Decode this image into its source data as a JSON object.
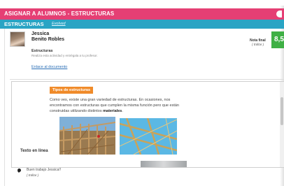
{
  "header": {
    "title": "ASIGNAR A ALUMNOS - ESTRUCTURAS"
  },
  "subheader": {
    "title": "ESTRUCTURAS",
    "link": "Evolved"
  },
  "student": {
    "first_name": "Jessica",
    "last_name": "Benito Robles"
  },
  "grade": {
    "label": "Nota final",
    "edit": "( Editar )",
    "value": "8,5",
    "color": "#3fb045"
  },
  "activity": {
    "title": "Estructuras",
    "description": "Realiza esta actividad y entrégala a tu profesor.",
    "document_link": "Enlace al documento"
  },
  "viewer": {
    "tag": "Tipos de estructuras",
    "paragraph_plain": "Como ves, existe una gran variedad de estructuras. En ocasiones, nos encontramos con estructuras que cumplen la misma función pero que están construidas utilizando distintos ",
    "paragraph_bold": "materiales",
    "paragraph_end": ".",
    "side_label": "Texto en línea"
  },
  "comment": {
    "text": "Buen trabajo Jessica!!",
    "edit": "( Editar )"
  },
  "colors": {
    "title_bar": "#e53f74",
    "sub_bar": "#2aa4c4",
    "tag": "#f08b2a",
    "link": "#2b6fb6"
  }
}
